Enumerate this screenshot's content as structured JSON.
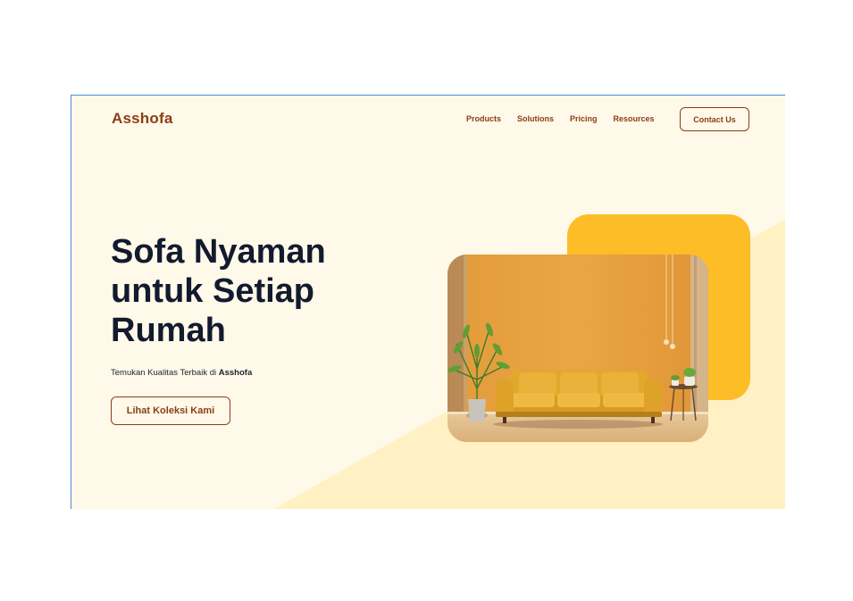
{
  "brand": {
    "name": "Asshofa"
  },
  "nav": {
    "items": [
      "Products",
      "Solutions",
      "Pricing",
      "Resources"
    ],
    "contact_label": "Contact Us"
  },
  "hero": {
    "title": "Sofa Nyaman untuk Setiap Rumah",
    "subtitle_prefix": "Temukan Kualitas Terbaik di ",
    "subtitle_brand": "Asshofa",
    "cta_label": "Lihat Koleksi Kami"
  },
  "colors": {
    "background": "#fff9e9",
    "accent_brown": "#8a3f14",
    "accent_yellow": "#fcbd27",
    "text_dark": "#121a2e"
  },
  "image": {
    "subject": "living-room-sofa-photo"
  }
}
